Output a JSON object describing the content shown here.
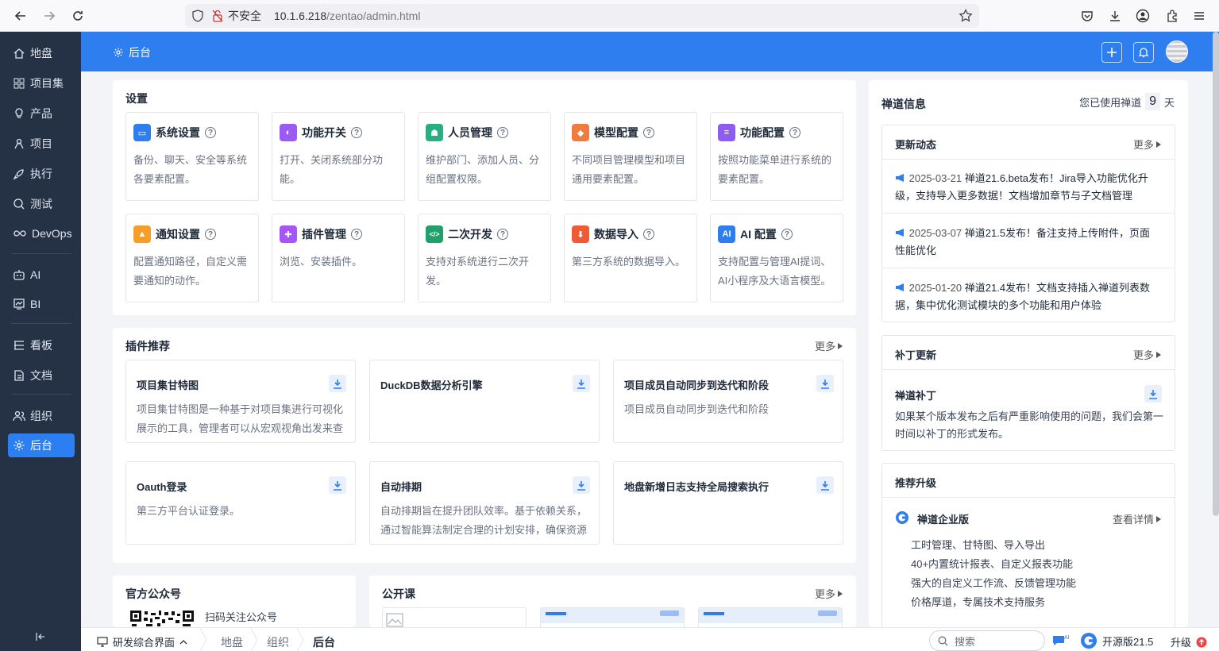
{
  "browser": {
    "security_label": "不安全",
    "url_host": "10.1.6.218",
    "url_path": "/zentao/admin.html"
  },
  "sidebar": {
    "items": [
      {
        "label": "地盘",
        "icon": "home-icon"
      },
      {
        "label": "项目集",
        "icon": "grid-icon"
      },
      {
        "label": "产品",
        "icon": "lightbulb-icon"
      },
      {
        "label": "项目",
        "icon": "person-icon"
      },
      {
        "label": "执行",
        "icon": "rocket-icon"
      },
      {
        "label": "测试",
        "icon": "search-icon"
      },
      {
        "label": "DevOps",
        "icon": "infinity-icon"
      },
      {
        "label": "AI",
        "icon": "robot-icon"
      },
      {
        "label": "BI",
        "icon": "chart-icon"
      },
      {
        "label": "看板",
        "icon": "board-icon"
      },
      {
        "label": "文档",
        "icon": "doc-icon"
      },
      {
        "label": "组织",
        "icon": "people-icon"
      },
      {
        "label": "后台",
        "icon": "gear-icon"
      }
    ]
  },
  "header": {
    "title": "后台"
  },
  "settings": {
    "title": "设置",
    "cards": [
      {
        "name": "系统设置",
        "desc": "备份、聊天、安全等系统各要素配置。",
        "color": "#2f7ef0",
        "glyph": "▭"
      },
      {
        "name": "功能开关",
        "desc": "打开、关闭系统部分功能。",
        "color": "#9b59f5",
        "glyph": "◐"
      },
      {
        "name": "人员管理",
        "desc": "维护部门、添加人员、分组配置权限。",
        "color": "#27ae82",
        "glyph": "☗"
      },
      {
        "name": "模型配置",
        "desc": "不同项目管理模型和项目通用要素配置。",
        "color": "#f07b3f",
        "glyph": "◆"
      },
      {
        "name": "功能配置",
        "desc": "按照功能菜单进行系统的要素配置。",
        "color": "#8e5cf0",
        "glyph": "≡"
      },
      {
        "name": "通知设置",
        "desc": "配置通知路径，自定义需要通知的动作。",
        "color": "#f59e2b",
        "glyph": "▲"
      },
      {
        "name": "插件管理",
        "desc": "浏览、安装插件。",
        "color": "#a855f7",
        "glyph": "✚"
      },
      {
        "name": "二次开发",
        "desc": "支持对系统进行二次开发。",
        "color": "#22a06b",
        "glyph": "</>"
      },
      {
        "name": "数据导入",
        "desc": "第三方系统的数据导入。",
        "color": "#ef5b34",
        "glyph": "⬇"
      },
      {
        "name": "AI 配置",
        "desc": "支持配置与管理AI提词、AI小程序及大语言模型。",
        "color": "#2f7ef0",
        "glyph": "AI"
      }
    ]
  },
  "plugins": {
    "title": "插件推荐",
    "more": "更多",
    "items": [
      {
        "name": "项目集甘特图",
        "desc": "项目集甘特图是一种基于对项目集进行可视化展示的工具，管理者可以从宏观视角出发来查"
      },
      {
        "name": "DuckDB数据分析引擎",
        "desc": ""
      },
      {
        "name": "项目成员自动同步到迭代和阶段",
        "desc": "项目成员自动同步到迭代和阶段"
      },
      {
        "name": "Oauth登录",
        "desc": "第三方平台认证登录。"
      },
      {
        "name": "自动排期",
        "desc": "自动排期旨在提升团队效率。基于依赖关系，通过智能算法制定合理的计划安排，确保资源"
      },
      {
        "name": "地盘新增日志支持全局搜索执行",
        "desc": ""
      }
    ]
  },
  "official": {
    "title": "官方公众号",
    "scan_text": "扫码关注公众号"
  },
  "courses": {
    "title": "公开课",
    "more": "更多"
  },
  "zentao_info": {
    "title": "禅道信息",
    "usage_prefix": "您已使用禅道",
    "days": "9",
    "usage_suffix": "天",
    "news": {
      "title": "更新动态",
      "more": "更多",
      "items": [
        {
          "date": "2025-03-21",
          "text": "禅道21.6.beta发布！Jira导入功能优化升级，支持导入更多数据！文档增加章节与子文档管理"
        },
        {
          "date": "2025-03-07",
          "text": "禅道21.5发布！备注支持上传附件，页面性能优化"
        },
        {
          "date": "2025-01-20",
          "text": "禅道21.4发布！文档支持插入禅道列表数据，集中优化测试模块的多个功能和用户体验"
        }
      ]
    },
    "patch": {
      "title": "补丁更新",
      "more": "更多",
      "name": "禅道补丁",
      "desc": "如果某个版本发布之后有严重影响使用的问题，我们会第一时间以补丁的形式发布。"
    },
    "upgrade": {
      "title": "推荐升级",
      "edition": "禅道企业版",
      "detail": "查看详情",
      "features": [
        "工时管理、甘特图、导入导出",
        "40+内置统计报表、自定义报表功能",
        "强大的自定义工作流、反馈管理功能",
        "价格厚道，专属技术支持服务"
      ]
    }
  },
  "bottom": {
    "workspace": "研发综合界面",
    "breadcrumbs": [
      "地盘",
      "组织",
      "后台"
    ],
    "search_placeholder": "搜索",
    "version": "开源版21.5",
    "upgrade": "升级"
  },
  "colors": {
    "primary": "#2f7ef0",
    "sidebar": "#253246"
  }
}
